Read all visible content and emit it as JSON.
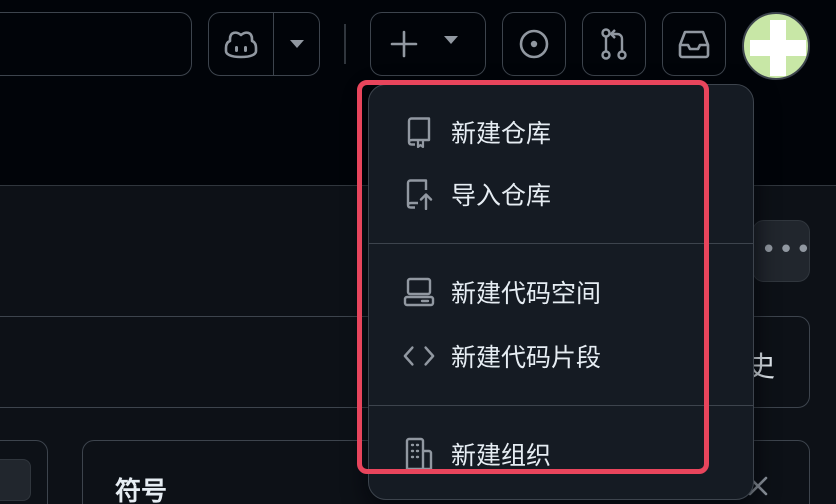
{
  "menu": {
    "items": [
      {
        "label": "新建仓库",
        "icon": "repo-icon"
      },
      {
        "label": "导入仓库",
        "icon": "repo-push-icon"
      },
      {
        "label": "新建代码空间",
        "icon": "codespaces-icon"
      },
      {
        "label": "新建代码片段",
        "icon": "code-icon"
      },
      {
        "label": "新建组织",
        "icon": "organization-icon"
      }
    ]
  },
  "content": {
    "panel_title": "符号",
    "partial_text": "史"
  },
  "colors": {
    "background": "#0d1117",
    "header": "#010409",
    "menu_bg": "#151b23",
    "border": "#3d444d",
    "highlight": "#e8455c",
    "text": "#e6edf3",
    "muted": "#9198a1"
  }
}
